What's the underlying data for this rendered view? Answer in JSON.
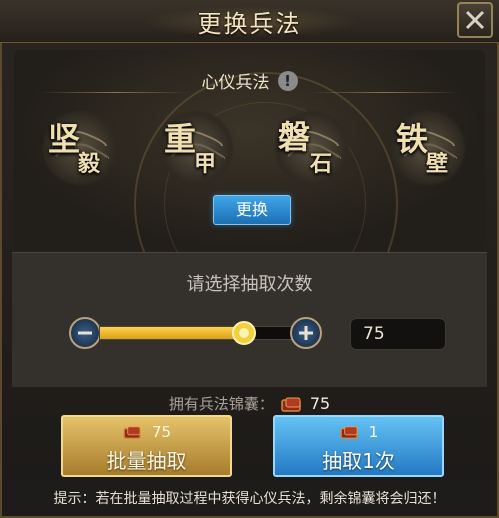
{
  "header": {
    "title": "更换兵法"
  },
  "section": {
    "label": "心仪兵法",
    "info_glyph": "!"
  },
  "skills": [
    {
      "big": "坚",
      "small": "毅"
    },
    {
      "big": "重",
      "small": "甲"
    },
    {
      "big": "磐",
      "small": "石"
    },
    {
      "big": "铁",
      "small": "壁"
    }
  ],
  "change_button": {
    "label": "更换"
  },
  "draw": {
    "prompt": "请选择抽取次数",
    "slider_fraction": 0.75,
    "count": "75"
  },
  "owned": {
    "label": "拥有兵法锦囊：",
    "value": "75"
  },
  "batch_button": {
    "cost": "75",
    "label": "批量抽取"
  },
  "single_button": {
    "cost": "1",
    "label": "抽取1次"
  },
  "tip": "提示：若在批量抽取过程中获得心仪兵法，剩余锦囊将会归还！",
  "colors": {
    "accent_gold": "#e6c26a",
    "accent_blue": "#3fa6e8"
  }
}
